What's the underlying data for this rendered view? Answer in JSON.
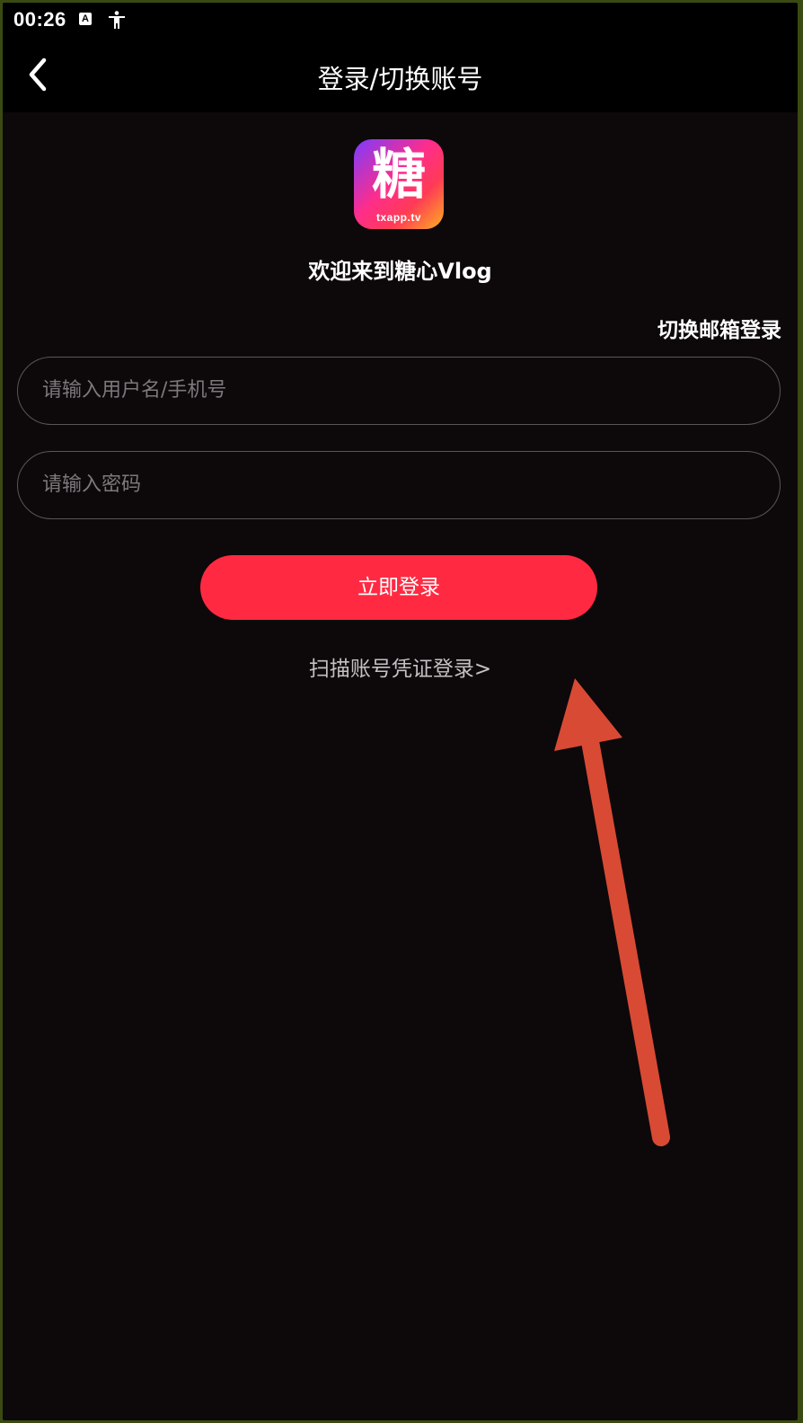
{
  "status_bar": {
    "time": "00:26",
    "icon_a_label": "A",
    "icons": [
      "text-a-icon",
      "accessibility-icon"
    ]
  },
  "app_bar": {
    "title": "登录/切换账号",
    "back_icon": "chevron-left-icon"
  },
  "logo": {
    "glyph": "糖",
    "domain_text": "txapp.tv"
  },
  "welcome_text": "欢迎来到糖心Vlog",
  "switch_email_label": "切换邮箱登录",
  "form": {
    "username": {
      "value": "",
      "placeholder": "请输入用户名/手机号"
    },
    "password": {
      "value": "",
      "placeholder": "请输入密码"
    },
    "login_button_label": "立即登录"
  },
  "scan_login_label": "扫描账号凭证登录>",
  "colors": {
    "background": "#0d080a",
    "bar_background": "#000000",
    "accent": "#ff2a42",
    "field_border": "#5a5558",
    "placeholder": "#7d787b",
    "annotation_arrow": "#d84a34"
  }
}
